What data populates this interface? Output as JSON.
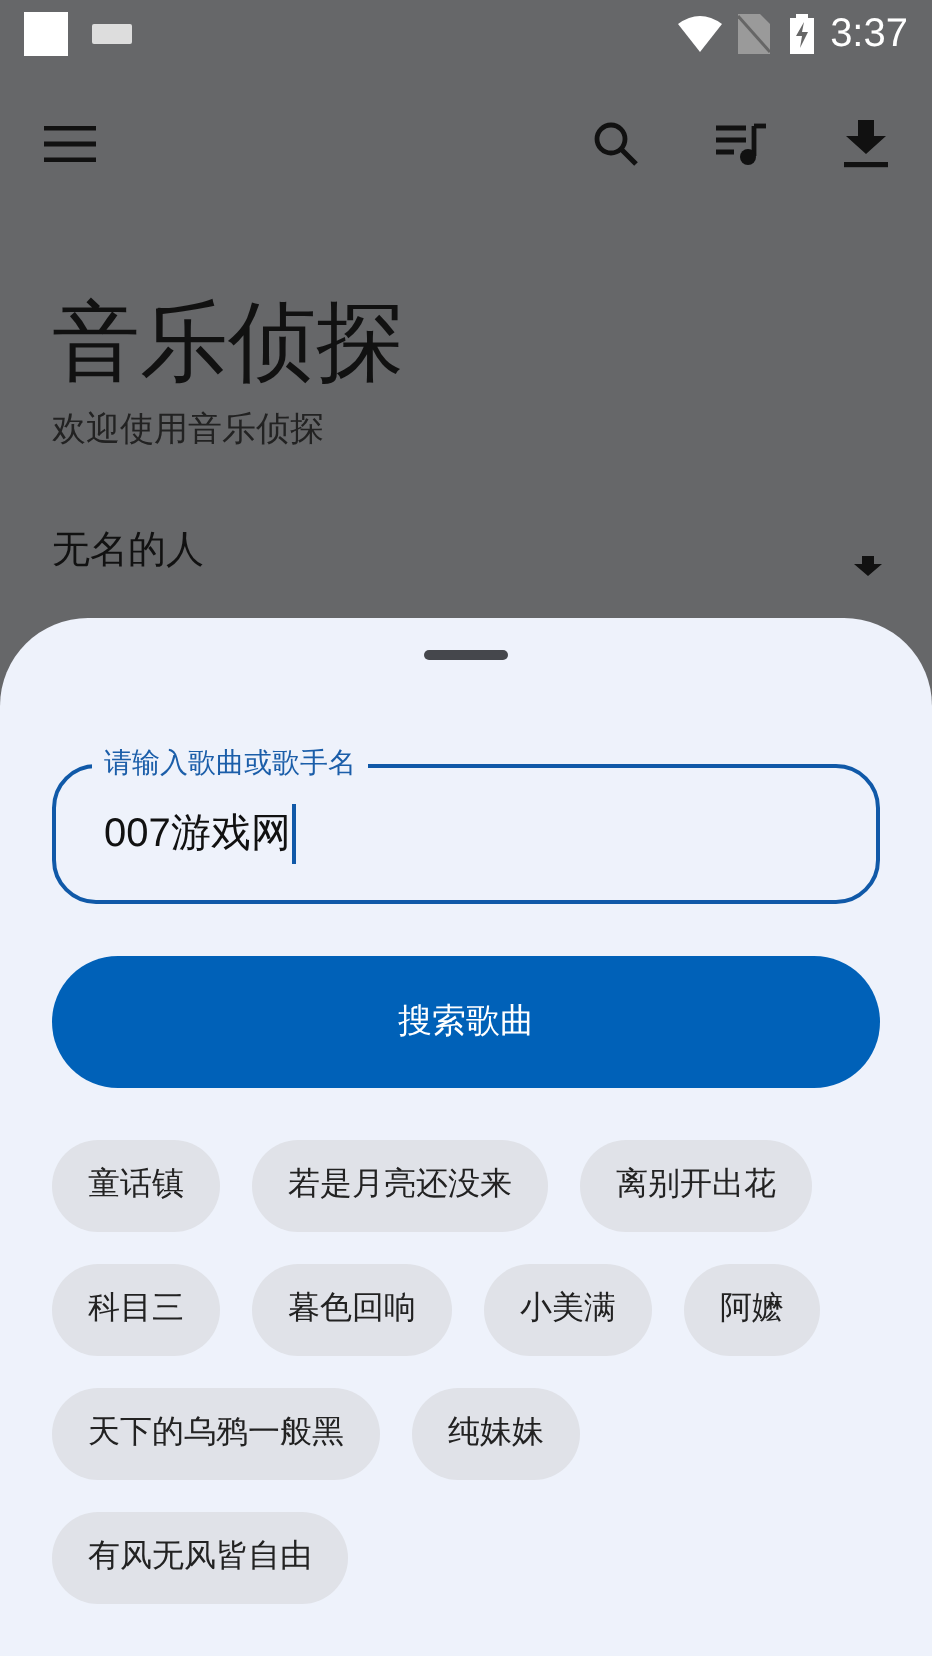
{
  "status_bar": {
    "time": "3:37"
  },
  "header": {
    "title": "音乐侦探",
    "subtitle": "欢迎使用音乐侦探"
  },
  "song_list": [
    {
      "title": "无名的人"
    }
  ],
  "bottom_sheet": {
    "search_field": {
      "label": "请输入歌曲或歌手名",
      "value": "007游戏网"
    },
    "search_button": "搜索歌曲",
    "chips": [
      {
        "label": "童话镇"
      },
      {
        "label": "若是月亮还没来"
      },
      {
        "label": "离别开出花"
      },
      {
        "label": "科目三"
      },
      {
        "label": "暮色回响"
      },
      {
        "label": "小美满"
      },
      {
        "label": "阿嬷"
      },
      {
        "label": "天下的乌鸦一般黑"
      },
      {
        "label": "纯妹妹"
      },
      {
        "label": "有风无风皆自由"
      }
    ]
  }
}
